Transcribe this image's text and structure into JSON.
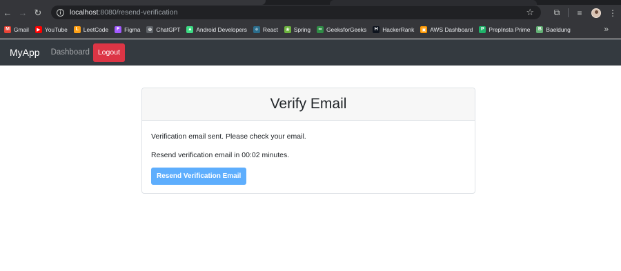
{
  "browser": {
    "url_host": "localhost",
    "url_rest": ":8080/resend-verification",
    "bookmarks": [
      {
        "label": "Gmail",
        "icon": "gmail-icon",
        "color": "#ea4335",
        "glyph": "M"
      },
      {
        "label": "YouTube",
        "icon": "youtube-icon",
        "color": "#ff0000",
        "glyph": "▶"
      },
      {
        "label": "LeetCode",
        "icon": "leetcode-icon",
        "color": "#ffa116",
        "glyph": "L"
      },
      {
        "label": "Figma",
        "icon": "figma-icon",
        "color": "#a259ff",
        "glyph": "F"
      },
      {
        "label": "ChatGPT",
        "icon": "chatgpt-icon",
        "color": "#5f6368",
        "glyph": "⊛"
      },
      {
        "label": "Android Developers",
        "icon": "android-icon",
        "color": "#3ddc84",
        "glyph": "▲"
      },
      {
        "label": "React",
        "icon": "react-icon",
        "color": "#2b6d8c",
        "glyph": "⚛"
      },
      {
        "label": "Spring",
        "icon": "spring-icon",
        "color": "#6db33f",
        "glyph": "❀"
      },
      {
        "label": "GeeksforGeeks",
        "icon": "geeksforgeeks-icon",
        "color": "#2f8d46",
        "glyph": "∞"
      },
      {
        "label": "HackerRank",
        "icon": "hackerrank-icon",
        "color": "#0e141e",
        "glyph": "H"
      },
      {
        "label": "AWS Dashboard",
        "icon": "aws-icon",
        "color": "#ff9900",
        "glyph": "▣"
      },
      {
        "label": "PrepInsta Prime",
        "icon": "prepinsta-icon",
        "color": "#1fb36a",
        "glyph": "P"
      },
      {
        "label": "Baeldung",
        "icon": "baeldung-icon",
        "color": "#63b175",
        "glyph": "B"
      }
    ]
  },
  "navbar": {
    "brand": "MyApp",
    "dashboard_label": "Dashboard",
    "logout_label": "Logout"
  },
  "card": {
    "title": "Verify Email",
    "message_sent": "Verification email sent. Please check your email.",
    "message_timer": "Resend verification email in 00:02 minutes.",
    "resend_label": "Resend Verification Email"
  },
  "colors": {
    "navbar_bg": "#343a40",
    "logout_bg": "#dc3545",
    "resend_bg": "#5eaefd"
  }
}
